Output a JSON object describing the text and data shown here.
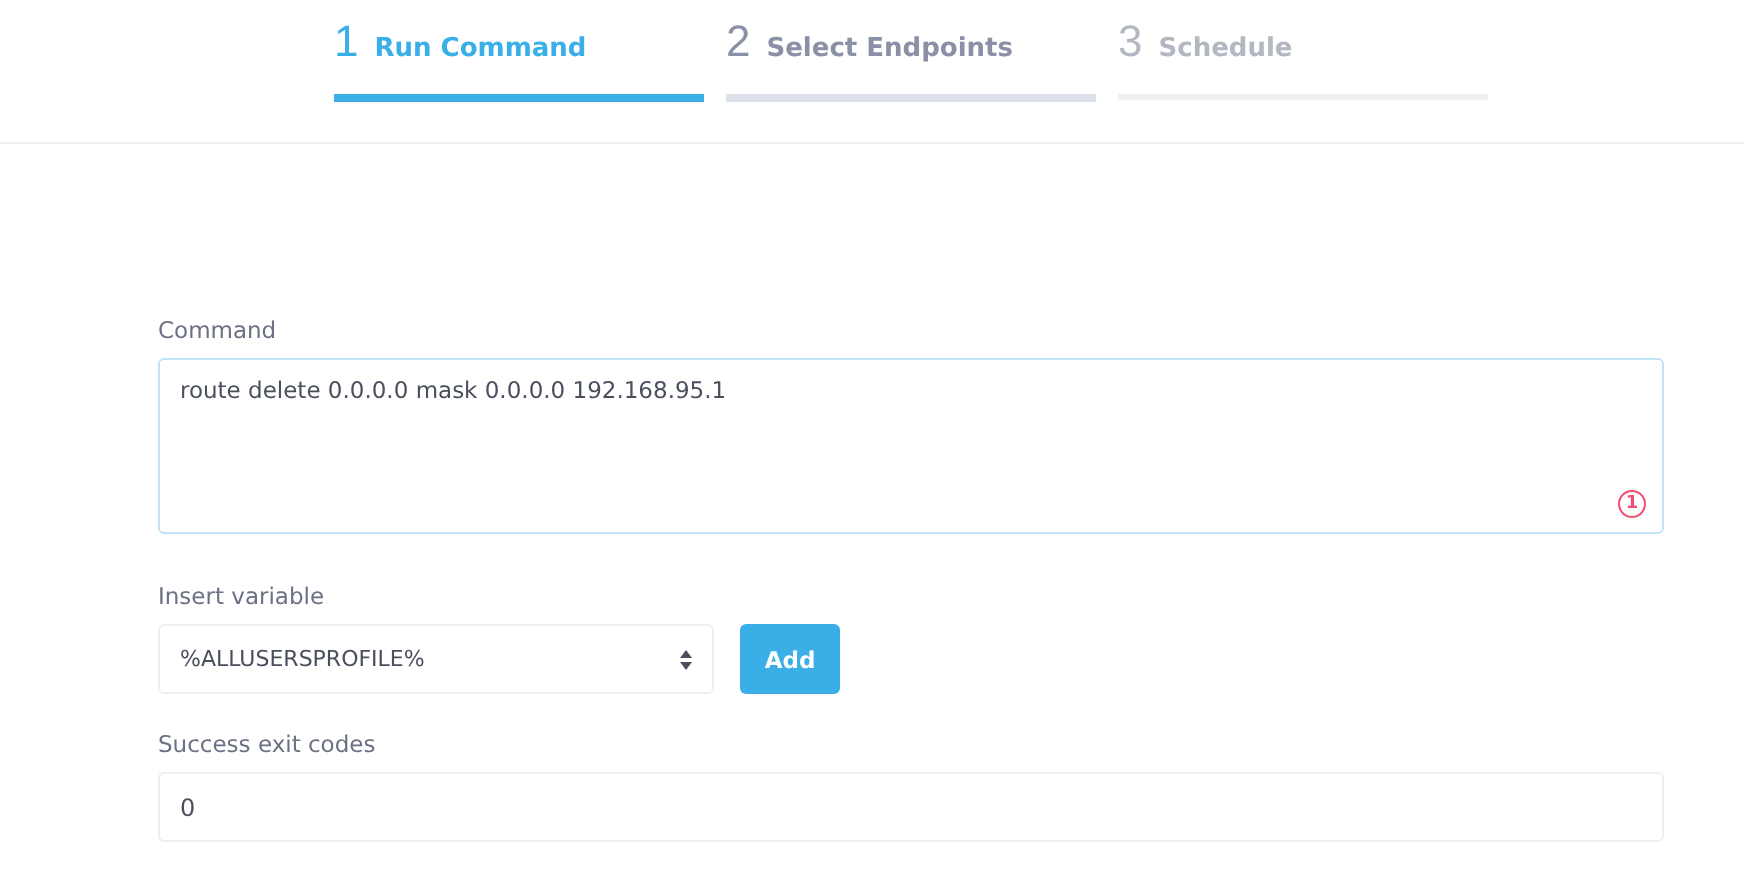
{
  "steps": [
    {
      "number": "1",
      "label": "Run Command",
      "selected": true,
      "disabled": false
    },
    {
      "number": "2",
      "label": "Select Endpoints",
      "selected": false,
      "disabled": false
    },
    {
      "number": "3",
      "label": "Schedule",
      "selected": false,
      "disabled": true
    }
  ],
  "command": {
    "label": "Command",
    "value": "route delete 0.0.0.0 mask 0.0.0.0 192.168.95.1",
    "issue_count": "1"
  },
  "insert_variable": {
    "label": "Insert variable",
    "value": "%ALLUSERSPROFILE%",
    "button": "Add"
  },
  "success_exit_codes": {
    "label": "Success exit codes",
    "value": "0"
  }
}
